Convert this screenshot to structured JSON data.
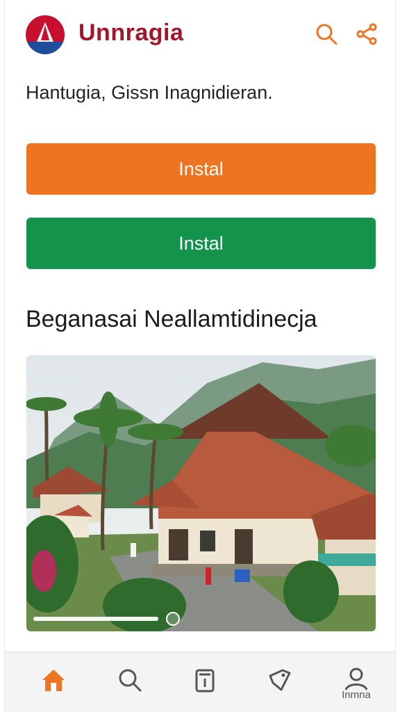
{
  "app": {
    "title": "Unnragia",
    "tagline": "Hantugia, Gissn Inagnidieran."
  },
  "buttons": {
    "primary_label": "Instal",
    "secondary_label": "Instal"
  },
  "section": {
    "title": "Beganasai Neallamtidinecja"
  },
  "hero": {
    "progress": 0.82
  },
  "bottom_nav": {
    "profile_label": "Inmna"
  },
  "colors": {
    "brand_red": "#a3172d",
    "accent_orange": "#ed7420",
    "accent_green": "#14934c"
  },
  "icons": [
    "logo-icon",
    "search-icon",
    "share-icon",
    "home-icon",
    "search-icon",
    "bookmark-icon",
    "tag-icon",
    "profile-icon"
  ]
}
